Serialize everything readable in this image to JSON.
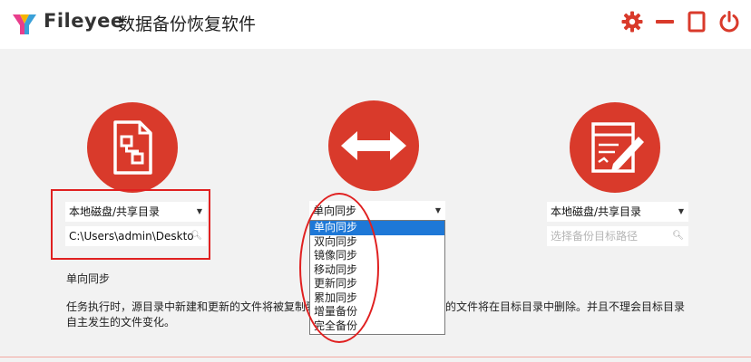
{
  "app": {
    "brand": "Fileyee",
    "title": "数据备份恢复软件"
  },
  "window_buttons": {
    "settings": "gear-icon",
    "minimize": "minimize-icon",
    "maximize": "maximize-icon",
    "power": "power-icon"
  },
  "source": {
    "type_value": "本地磁盘/共享目录",
    "path_value": "C:\\Users\\admin\\Deskto"
  },
  "mode": {
    "selected": "单向同步",
    "options": [
      "单向同步",
      "双向同步",
      "镜像同步",
      "移动同步",
      "更新同步",
      "累加同步",
      "增量备份",
      "完全备份"
    ]
  },
  "target": {
    "type_value": "本地磁盘/共享目录",
    "path_placeholder": "选择备份目标路径"
  },
  "description": {
    "mode_name": "单向同步",
    "line1_left": "任务执行时，源目录中新建和更新的文件将被复制到",
    "line1_right": "的文件将在目标目录中删除。并且不理会目标目录",
    "line2": "自主发生的文件变化。"
  },
  "colors": {
    "accent": "#d93a2b",
    "highlight": "#e02020",
    "selection": "#1e78d7"
  }
}
